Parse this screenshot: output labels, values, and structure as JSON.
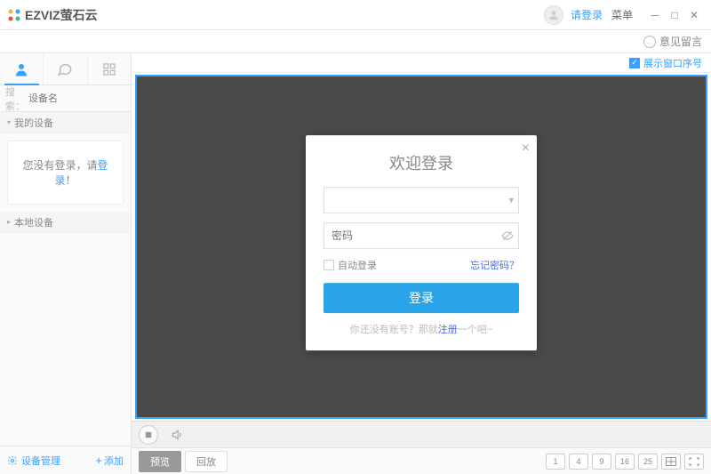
{
  "titlebar": {
    "brand": "EZVIZ萤石云",
    "login_link": "请登录",
    "menu_label": "菜单"
  },
  "secondbar": {
    "feedback": "意见留言"
  },
  "sidebar": {
    "search_label": "搜索：",
    "search_placeholder": "设备名",
    "my_devices": "我的设备",
    "local_devices": "本地设备",
    "not_logged_prefix": "您没有登录，请",
    "not_logged_link": "登录",
    "not_logged_suffix": "！",
    "device_mgmt": "设备管理",
    "add_label": "添加"
  },
  "main": {
    "show_window_index": "展示窗口序号"
  },
  "footer": {
    "preview": "预览",
    "playback": "回放",
    "layouts": [
      "1",
      "4",
      "9",
      "16",
      "25"
    ]
  },
  "dialog": {
    "title": "欢迎登录",
    "username_placeholder": "",
    "password_placeholder": "密码",
    "auto_login": "自动登录",
    "forgot": "忘记密码？",
    "login_btn": "登录",
    "register_prefix": "你还没有账号？那就",
    "register_link": "注册",
    "register_suffix": "一个吧~"
  }
}
